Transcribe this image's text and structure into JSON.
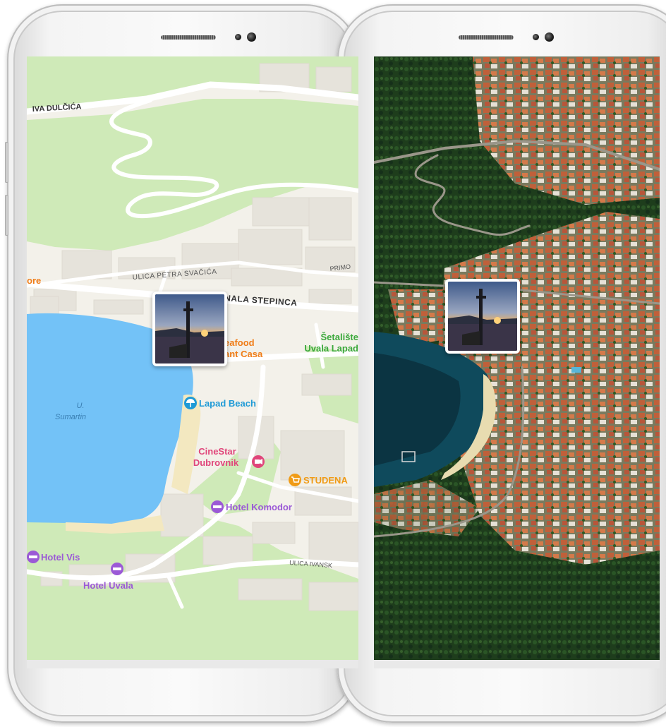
{
  "left_map": {
    "streets": {
      "iva_dulcica": "IVA DULČIĆA",
      "petra_svacica": "ULICA PETRA SVAČIĆA",
      "primo": "PRIMO",
      "stepinca": "NALA STEPINCA",
      "ivanska": "ULICA IVANSK"
    },
    "places": {
      "ore": "ore",
      "seafood_line1": "eafood",
      "seafood_line2": "ant Casa",
      "setaliste_line1": "Šetalište",
      "setaliste_line2": "Uvala Lapad",
      "bay_line1": "U.",
      "bay_line2": "Sumartin",
      "lapad_beach": "Lapad Beach",
      "cinestar_line1": "CineStar",
      "cinestar_line2": "Dubrovnik",
      "studena": "STUDENA",
      "hotel_komodor": "Hotel Komodor",
      "hotel_vis": "Hotel Vis",
      "hotel_uvala": "Hotel Uvala"
    }
  },
  "colors": {
    "land": "#f3f1ea",
    "park": "#cfeab8",
    "water": "#73c2f7",
    "road": "#ffffff",
    "restaurant": "#f07c16",
    "park_label": "#3aa83a",
    "beach": "#1e9ad6",
    "cinema": "#e0457a",
    "hotel": "#9b59d6",
    "shop": "#f09b16",
    "satellite_forest": "#1e3d1c",
    "satellite_water": "#0f4a5c"
  },
  "icons": [
    "photo-pin-icon",
    "beach-umbrella-icon",
    "cinema-icon",
    "shopping-cart-icon",
    "bed-icon"
  ]
}
